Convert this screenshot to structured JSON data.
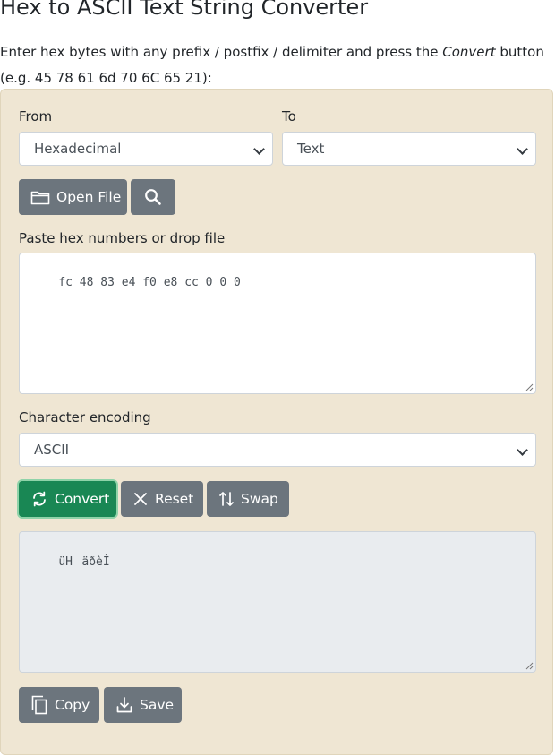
{
  "title": "Hex to ASCII Text String Converter",
  "intro": {
    "line1_pre": "Enter hex bytes with any prefix / postfix / delimiter and press the ",
    "line1_em": "Convert",
    "line1_post": " button",
    "line2": "(e.g. 45 78 61 6d 70 6C 65 21):"
  },
  "from": {
    "label": "From",
    "value": "Hexadecimal"
  },
  "to": {
    "label": "To",
    "value": "Text"
  },
  "buttons": {
    "open_file": "Open File",
    "convert": "Convert",
    "reset": "Reset",
    "swap": "Swap",
    "copy": "Copy",
    "save": "Save"
  },
  "input": {
    "label": "Paste hex numbers or drop file",
    "value": "fc 48 83 e4 f0 e8 cc 0 0 0"
  },
  "encoding": {
    "label": "Character encoding",
    "value": "ASCII"
  },
  "output": {
    "value": "üHäðèÌ"
  },
  "colors": {
    "panel": "#efe6d3",
    "button": "#6c757d",
    "convert": "#198754"
  }
}
